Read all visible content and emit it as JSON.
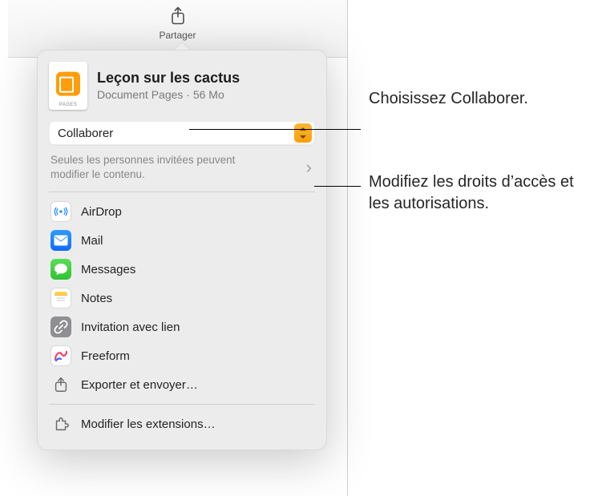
{
  "toolbar": {
    "share_label": "Partager"
  },
  "document": {
    "icon_caption": "PAGES",
    "title": "Leçon sur les cactus",
    "subtitle": "Document Pages · 56 Mo"
  },
  "mode": {
    "value": "Collaborer"
  },
  "permissions": {
    "desc": "Seules les personnes invitées peuvent modifier le contenu."
  },
  "share_targets": [
    {
      "key": "airdrop",
      "label": "AirDrop"
    },
    {
      "key": "mail",
      "label": "Mail"
    },
    {
      "key": "messages",
      "label": "Messages"
    },
    {
      "key": "notes",
      "label": "Notes"
    },
    {
      "key": "link",
      "label": "Invitation avec lien"
    },
    {
      "key": "freeform",
      "label": "Freeform"
    },
    {
      "key": "export",
      "label": "Exporter et envoyer…"
    }
  ],
  "edit_ext": {
    "label": "Modifier les extensions…"
  },
  "callouts": {
    "c1": "Choisissez Collaborer.",
    "c2": "Modifiez les droits d’accès et les autorisations."
  }
}
